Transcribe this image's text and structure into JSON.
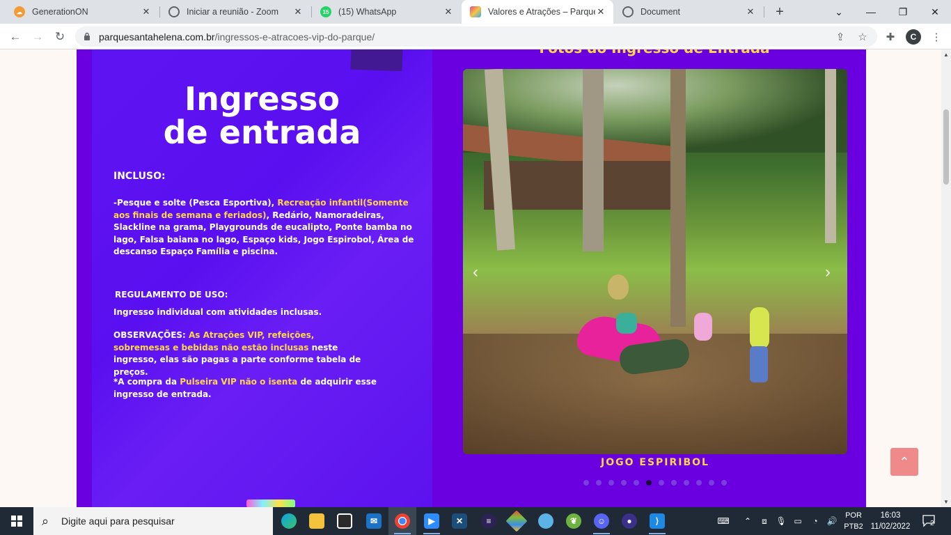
{
  "browser": {
    "tabs": [
      {
        "title": "GenerationON",
        "favicon_color": "#f29c38"
      },
      {
        "title": "Iniciar a reunião - Zoom",
        "favicon_color": "#5f6368"
      },
      {
        "title": "(15) WhatsApp",
        "favicon_color": "#25d366",
        "badge": "15"
      },
      {
        "title": "Valores e Atrações – Parque S",
        "favicon_color": "#e64a8a",
        "active": true
      },
      {
        "title": "Document",
        "favicon_color": "#5f6368"
      }
    ],
    "address": {
      "host": "parquesantahelena.com.br",
      "path": "/ingressos-e-atracoes-vip-do-parque/"
    },
    "profile_initial": "C"
  },
  "page": {
    "ticket_card": {
      "title_line1": "Ingresso",
      "title_line2": "de entrada",
      "included_heading": "INCLUSO:",
      "included_part1": "-Pesque e solte ",
      "included_part2": "(Pesca Esportiva)",
      "included_part3": ", ",
      "included_part4": "Recreação infantil",
      "included_part5": "(Somente aos finais de semana e feriados)",
      "included_part6": ", Redário, Namoradeiras, Slackline na grama, Playgrounds de eucalipto, Ponte bamba no lago, Falsa baiana no lago, Espaço kids, Jogo Espirobol, Área de descanso ",
      "included_part7": "Espaço Família",
      "included_part8": " e piscina.",
      "rules_heading": "REGULAMENTO DE USO:",
      "rules_text": "Ingresso individual com atividades inclusas.",
      "obs_label": "OBSERVAÇÕES: ",
      "obs_highlight": "As Atrações VIP, refeições, sobremesas e bebidas não estão inclusas",
      "obs_rest": " neste ingresso, elas são pagas a parte conforme tabela de preços.",
      "note_part1": "*A compra da ",
      "note_part2": "Pulseira VIP",
      "note_part3": " não o isenta",
      "note_part4": " de adquirir esse ingresso de entrada."
    },
    "photos_title": "Fotos do Ingresso de Entrada",
    "carousel": {
      "caption": "JOGO ESPIRIBOL",
      "total_slides": 12,
      "active_slide": 5
    },
    "back_to_top_icon": "chevron-up-icon"
  },
  "taskbar": {
    "search_placeholder": "Digite aqui para pesquisar",
    "apps": [
      "edge",
      "file-explorer",
      "store",
      "mail",
      "chrome",
      "zoom",
      "vs-icon",
      "eclipse",
      "git",
      "paint",
      "spring",
      "discord",
      "obs",
      "vscode"
    ],
    "language_line1": "POR",
    "language_line2": "PTB2",
    "time": "16:03",
    "date": "11/02/2022",
    "notification_count": "2"
  }
}
